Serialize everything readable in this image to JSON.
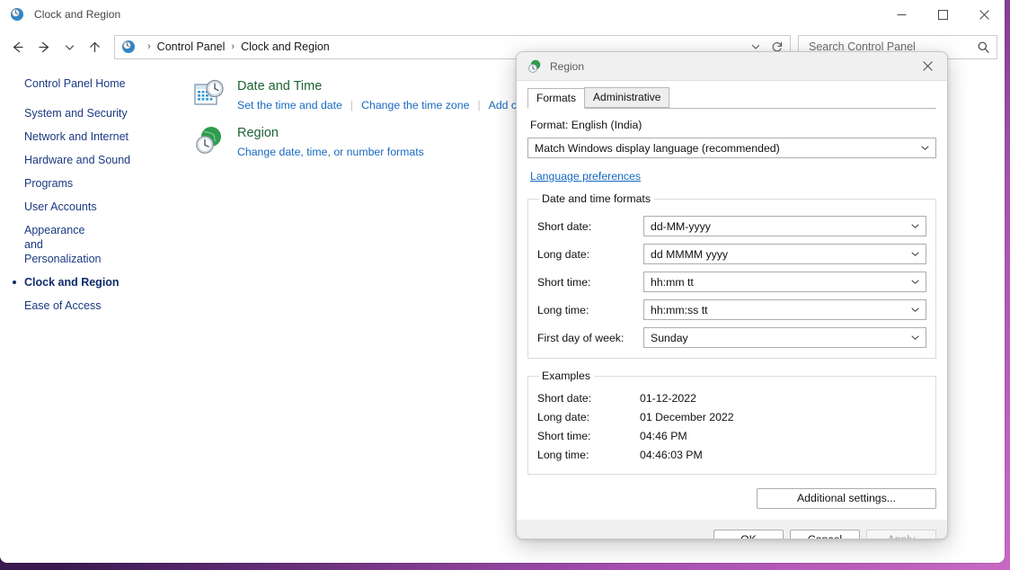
{
  "window": {
    "title": "Clock and Region",
    "icon": "clock-globe-icon",
    "minimize_label": "Minimize",
    "maximize_label": "Maximize",
    "close_label": "Close"
  },
  "navbar": {
    "back_label": "Back",
    "forward_label": "Forward",
    "recent_label": "Recent locations",
    "up_label": "Up",
    "address_icon": "control-panel-icon",
    "breadcrumbs": [
      "Control Panel",
      "Clock and Region"
    ],
    "separator": "›",
    "dropdown_label": "Previous locations",
    "refresh_label": "Refresh"
  },
  "search": {
    "placeholder": "Search Control Panel",
    "value": "",
    "icon": "search-icon"
  },
  "sidebar": {
    "items": [
      {
        "label": "Control Panel Home",
        "current": false
      },
      {
        "label": "System and Security",
        "current": false
      },
      {
        "label": "Network and Internet",
        "current": false
      },
      {
        "label": "Hardware and Sound",
        "current": false
      },
      {
        "label": "Programs",
        "current": false
      },
      {
        "label": "User Accounts",
        "current": false
      },
      {
        "label": "Appearance and Personalization",
        "current": false
      },
      {
        "label": "Clock and Region",
        "current": true
      },
      {
        "label": "Ease of Access",
        "current": false
      }
    ]
  },
  "main": {
    "categories": [
      {
        "title": "Date and Time",
        "icon": "calendar-clock-icon",
        "links": [
          "Set the time and date",
          "Change the time zone",
          "Add clo"
        ]
      },
      {
        "title": "Region",
        "icon": "globe-clock-icon",
        "links": [
          "Change date, time, or number formats"
        ]
      }
    ]
  },
  "dialog": {
    "title": "Region",
    "icon": "region-globe-icon",
    "close_label": "Close",
    "tabs": [
      {
        "label": "Formats",
        "active": true
      },
      {
        "label": "Administrative",
        "active": false
      }
    ],
    "format_label": "Format: English (India)",
    "format_value": "Match Windows display language (recommended)",
    "language_preferences_link": "Language preferences",
    "date_time_formats": {
      "legend": "Date and time formats",
      "fields": [
        {
          "label": "Short date:",
          "value": "dd-MM-yyyy"
        },
        {
          "label": "Long date:",
          "value": "dd MMMM yyyy"
        },
        {
          "label": "Short time:",
          "value": "hh:mm tt"
        },
        {
          "label": "Long time:",
          "value": "hh:mm:ss tt"
        },
        {
          "label": "First day of week:",
          "value": "Sunday"
        }
      ]
    },
    "examples": {
      "legend": "Examples",
      "rows": [
        {
          "label": "Short date:",
          "value": "01-12-2022"
        },
        {
          "label": "Long date:",
          "value": "01 December 2022"
        },
        {
          "label": "Short time:",
          "value": "04:46 PM"
        },
        {
          "label": "Long time:",
          "value": "04:46:03 PM"
        }
      ]
    },
    "additional_settings_label": "Additional settings...",
    "buttons": {
      "ok": "OK",
      "cancel": "Cancel",
      "apply": "Apply",
      "apply_enabled": false
    }
  },
  "colors": {
    "link": "#1668c1",
    "category_title": "#1d6333",
    "sidebar_link": "#1b3a82",
    "desktop": "#3b1a52"
  }
}
